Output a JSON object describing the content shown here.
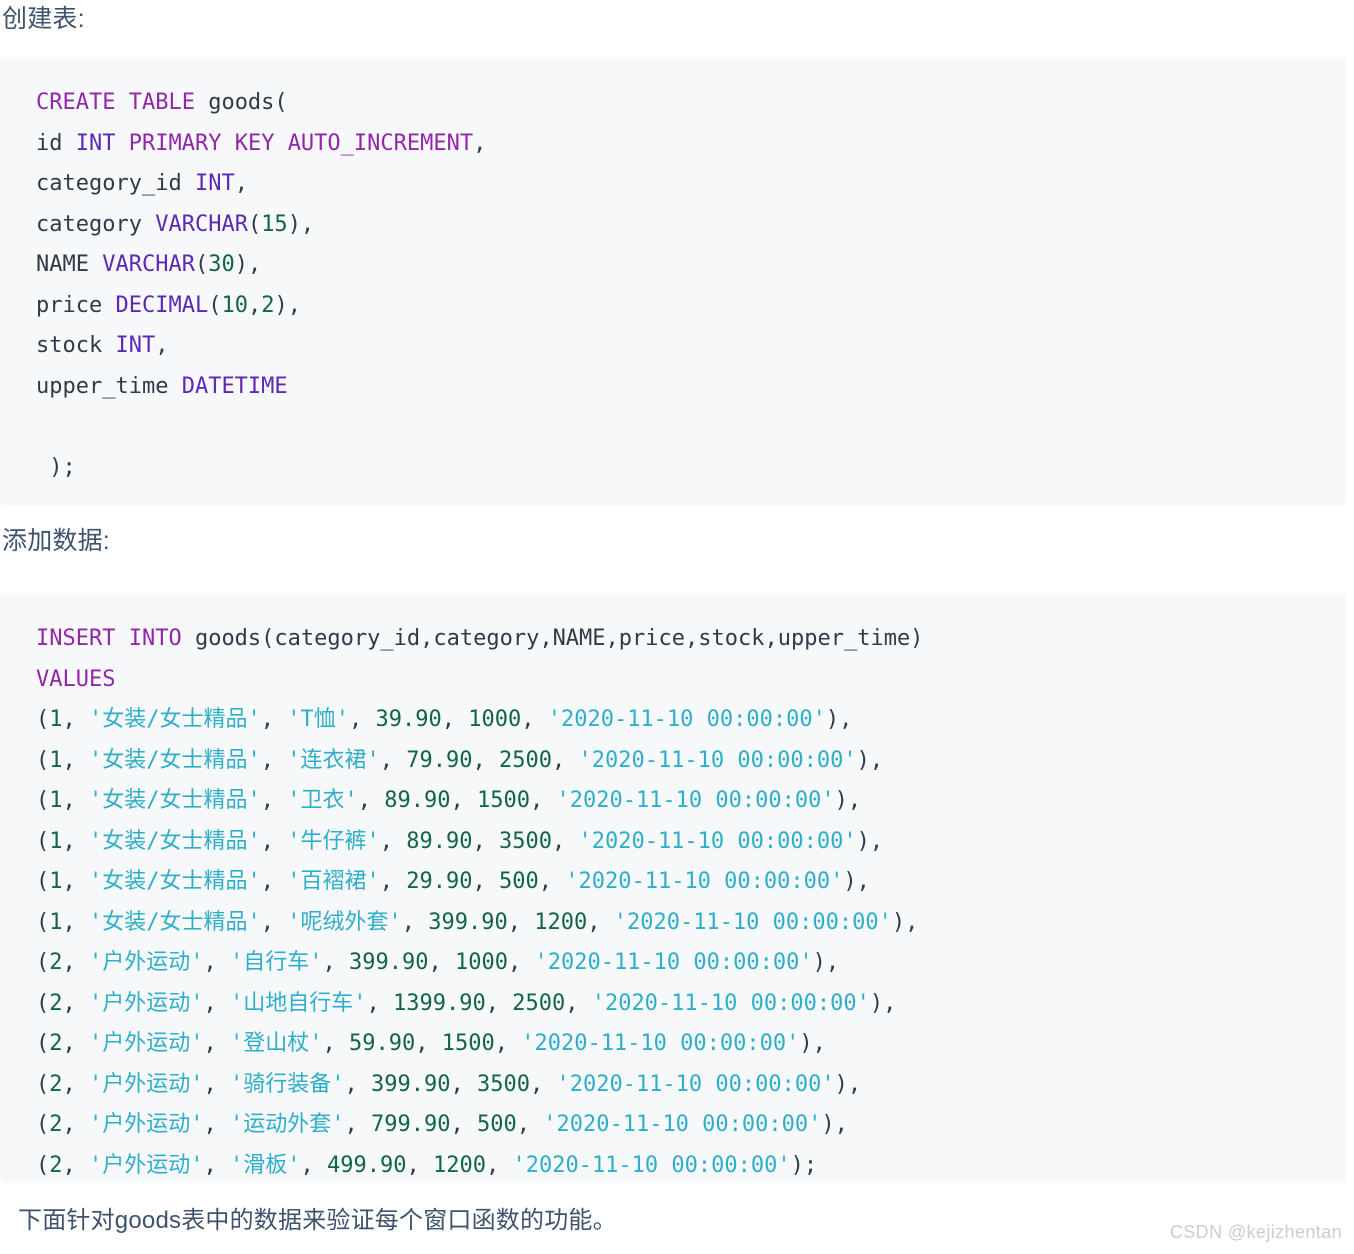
{
  "headings": {
    "create": "创建表:",
    "insert": "添加数据:"
  },
  "footer": {
    "note": "下面针对goods表中的数据来验证每个窗口函数的功能。"
  },
  "watermark": {
    "text": "CSDN @kejizhentan"
  },
  "colors": {
    "page_background": "#ffffff",
    "code_background": "#f7f8f9",
    "prose_text": "#3f536e",
    "keyword": "#9326a9",
    "type": "#5c28b5",
    "identifier": "#2f3b49",
    "number": "#116644",
    "string": "#2eafc9",
    "watermark": "#c9cdd2"
  },
  "code_blocks": {
    "create_table": {
      "language": "sql",
      "plain_text": "CREATE TABLE goods(\nid INT PRIMARY KEY AUTO_INCREMENT,\ncategory_id INT,\ncategory VARCHAR(15),\nNAME VARCHAR(30),\nprice DECIMAL(10,2),\nstock INT,\nupper_time DATETIME\n\n);",
      "lines": [
        {
          "id": "c1",
          "tokens": [
            {
              "t": "CREATE TABLE",
              "c": "keyword"
            },
            {
              "t": " goods(",
              "c": "ident"
            }
          ]
        },
        {
          "id": "c2",
          "tokens": [
            {
              "t": "id ",
              "c": "ident"
            },
            {
              "t": "INT",
              "c": "type"
            },
            {
              "t": " ",
              "c": "ident"
            },
            {
              "t": "PRIMARY KEY AUTO_INCREMENT",
              "c": "keyword"
            },
            {
              "t": ",",
              "c": "punct"
            }
          ]
        },
        {
          "id": "c3",
          "tokens": [
            {
              "t": "category_id ",
              "c": "ident"
            },
            {
              "t": "INT",
              "c": "type"
            },
            {
              "t": ",",
              "c": "punct"
            }
          ]
        },
        {
          "id": "c4",
          "tokens": [
            {
              "t": "category ",
              "c": "ident"
            },
            {
              "t": "VARCHAR",
              "c": "type"
            },
            {
              "t": "(",
              "c": "punct"
            },
            {
              "t": "15",
              "c": "number"
            },
            {
              "t": "),",
              "c": "punct"
            }
          ]
        },
        {
          "id": "c5",
          "tokens": [
            {
              "t": "NAME",
              "c": "ident"
            },
            {
              "t": " ",
              "c": "ident"
            },
            {
              "t": "VARCHAR",
              "c": "type"
            },
            {
              "t": "(",
              "c": "punct"
            },
            {
              "t": "30",
              "c": "number"
            },
            {
              "t": "),",
              "c": "punct"
            }
          ]
        },
        {
          "id": "c6",
          "tokens": [
            {
              "t": "price ",
              "c": "ident"
            },
            {
              "t": "DECIMAL",
              "c": "type"
            },
            {
              "t": "(",
              "c": "punct"
            },
            {
              "t": "10",
              "c": "number"
            },
            {
              "t": ",",
              "c": "punct"
            },
            {
              "t": "2",
              "c": "number"
            },
            {
              "t": "),",
              "c": "punct"
            }
          ]
        },
        {
          "id": "c7",
          "tokens": [
            {
              "t": "stock ",
              "c": "ident"
            },
            {
              "t": "INT",
              "c": "type"
            },
            {
              "t": ",",
              "c": "punct"
            }
          ]
        },
        {
          "id": "c8",
          "tokens": [
            {
              "t": "upper_time ",
              "c": "ident"
            },
            {
              "t": "DATETIME",
              "c": "type"
            }
          ]
        },
        {
          "id": "c9",
          "tokens": [
            {
              "t": " ",
              "c": "ident"
            }
          ]
        },
        {
          "id": "c10",
          "tokens": [
            {
              "t": " );",
              "c": "punct"
            }
          ]
        }
      ]
    },
    "insert_data": {
      "language": "sql",
      "plain_text": "INSERT INTO goods(category_id,category,NAME,price,stock,upper_time)\nVALUES\n(1, '女装/女士精品', 'T恤', 39.90, 1000, '2020-11-10 00:00:00'),\n(1, '女装/女士精品', '连衣裙', 79.90, 2500, '2020-11-10 00:00:00'),\n(1, '女装/女士精品', '卫衣', 89.90, 1500, '2020-11-10 00:00:00'),\n(1, '女装/女士精品', '牛仔裤', 89.90, 3500, '2020-11-10 00:00:00'),\n(1, '女装/女士精品', '百褶裙', 29.90, 500, '2020-11-10 00:00:00'),\n(1, '女装/女士精品', '呢绒外套', 399.90, 1200, '2020-11-10 00:00:00'),\n(2, '户外运动', '自行车', 399.90, 1000, '2020-11-10 00:00:00'),\n(2, '户外运动', '山地自行车', 1399.90, 2500, '2020-11-10 00:00:00'),\n(2, '户外运动', '登山杖', 59.90, 1500, '2020-11-10 00:00:00'),\n(2, '户外运动', '骑行装备', 399.90, 3500, '2020-11-10 00:00:00'),\n(2, '户外运动', '运动外套', 799.90, 500, '2020-11-10 00:00:00'),\n(2, '户外运动', '滑板', 499.90, 1200, '2020-11-10 00:00:00');",
      "header_lines": [
        {
          "id": "i1",
          "tokens": [
            {
              "t": "INSERT INTO",
              "c": "keyword"
            },
            {
              "t": " goods(category_id,category,NAME,price,stock,upper_time)",
              "c": "ident"
            }
          ]
        },
        {
          "id": "i2",
          "tokens": [
            {
              "t": "VALUES",
              "c": "keyword"
            }
          ]
        }
      ],
      "columns": [
        "category_id",
        "category",
        "NAME",
        "price",
        "stock",
        "upper_time"
      ],
      "rows": [
        {
          "category_id": "1",
          "category": "女装/女士精品",
          "name": "T恤",
          "price": "39.90",
          "stock": "1000",
          "upper_time": "2020-11-10 00:00:00",
          "terminator": ","
        },
        {
          "category_id": "1",
          "category": "女装/女士精品",
          "name": "连衣裙",
          "price": "79.90",
          "stock": "2500",
          "upper_time": "2020-11-10 00:00:00",
          "terminator": ","
        },
        {
          "category_id": "1",
          "category": "女装/女士精品",
          "name": "卫衣",
          "price": "89.90",
          "stock": "1500",
          "upper_time": "2020-11-10 00:00:00",
          "terminator": ","
        },
        {
          "category_id": "1",
          "category": "女装/女士精品",
          "name": "牛仔裤",
          "price": "89.90",
          "stock": "3500",
          "upper_time": "2020-11-10 00:00:00",
          "terminator": ","
        },
        {
          "category_id": "1",
          "category": "女装/女士精品",
          "name": "百褶裙",
          "price": "29.90",
          "stock": "500",
          "upper_time": "2020-11-10 00:00:00",
          "terminator": ","
        },
        {
          "category_id": "1",
          "category": "女装/女士精品",
          "name": "呢绒外套",
          "price": "399.90",
          "stock": "1200",
          "upper_time": "2020-11-10 00:00:00",
          "terminator": ","
        },
        {
          "category_id": "2",
          "category": "户外运动",
          "name": "自行车",
          "price": "399.90",
          "stock": "1000",
          "upper_time": "2020-11-10 00:00:00",
          "terminator": ","
        },
        {
          "category_id": "2",
          "category": "户外运动",
          "name": "山地自行车",
          "price": "1399.90",
          "stock": "2500",
          "upper_time": "2020-11-10 00:00:00",
          "terminator": ","
        },
        {
          "category_id": "2",
          "category": "户外运动",
          "name": "登山杖",
          "price": "59.90",
          "stock": "1500",
          "upper_time": "2020-11-10 00:00:00",
          "terminator": ","
        },
        {
          "category_id": "2",
          "category": "户外运动",
          "name": "骑行装备",
          "price": "399.90",
          "stock": "3500",
          "upper_time": "2020-11-10 00:00:00",
          "terminator": ","
        },
        {
          "category_id": "2",
          "category": "户外运动",
          "name": "运动外套",
          "price": "799.90",
          "stock": "500",
          "upper_time": "2020-11-10 00:00:00",
          "terminator": ","
        },
        {
          "category_id": "2",
          "category": "户外运动",
          "name": "滑板",
          "price": "499.90",
          "stock": "1200",
          "upper_time": "2020-11-10 00:00:00",
          "terminator": ";"
        }
      ]
    }
  }
}
